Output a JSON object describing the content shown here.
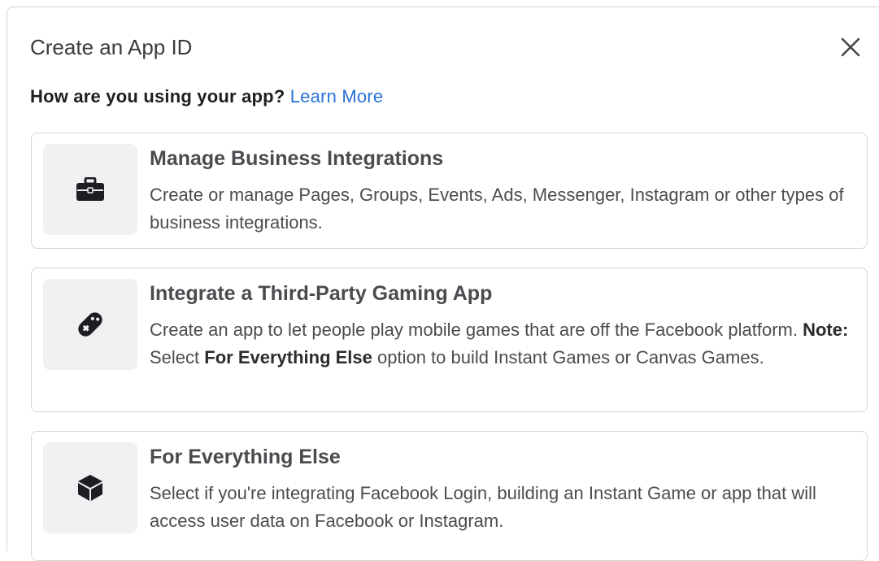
{
  "dialog": {
    "title": "Create an App ID",
    "close_icon": "close-icon"
  },
  "question": {
    "text": "How are you using your app?",
    "link": "Learn More"
  },
  "options": [
    {
      "icon": "briefcase-icon",
      "title": "Manage Business Integrations",
      "desc": "Create or manage Pages, Groups, Events, Ads, Messenger, Instagram or other types of business integrations."
    },
    {
      "icon": "game-controller-icon",
      "title": "Integrate a Third-Party Gaming App",
      "desc_part1": "Create an app to let people play mobile games that are off the Facebook platform. ",
      "desc_note": "Note:",
      "desc_part2": " Select ",
      "desc_emph": "For Everything Else",
      "desc_part3": " option to build Instant Games or Canvas Games."
    },
    {
      "icon": "cube-icon",
      "title": "For Everything Else",
      "desc": "Select if you're integrating Facebook Login, building an Instant Game or app that will access user data on Facebook or Instagram."
    }
  ],
  "colors": {
    "link": "#2a72d9",
    "card_border": "#d3d5d9",
    "icon_bg": "#f0f1f3"
  }
}
